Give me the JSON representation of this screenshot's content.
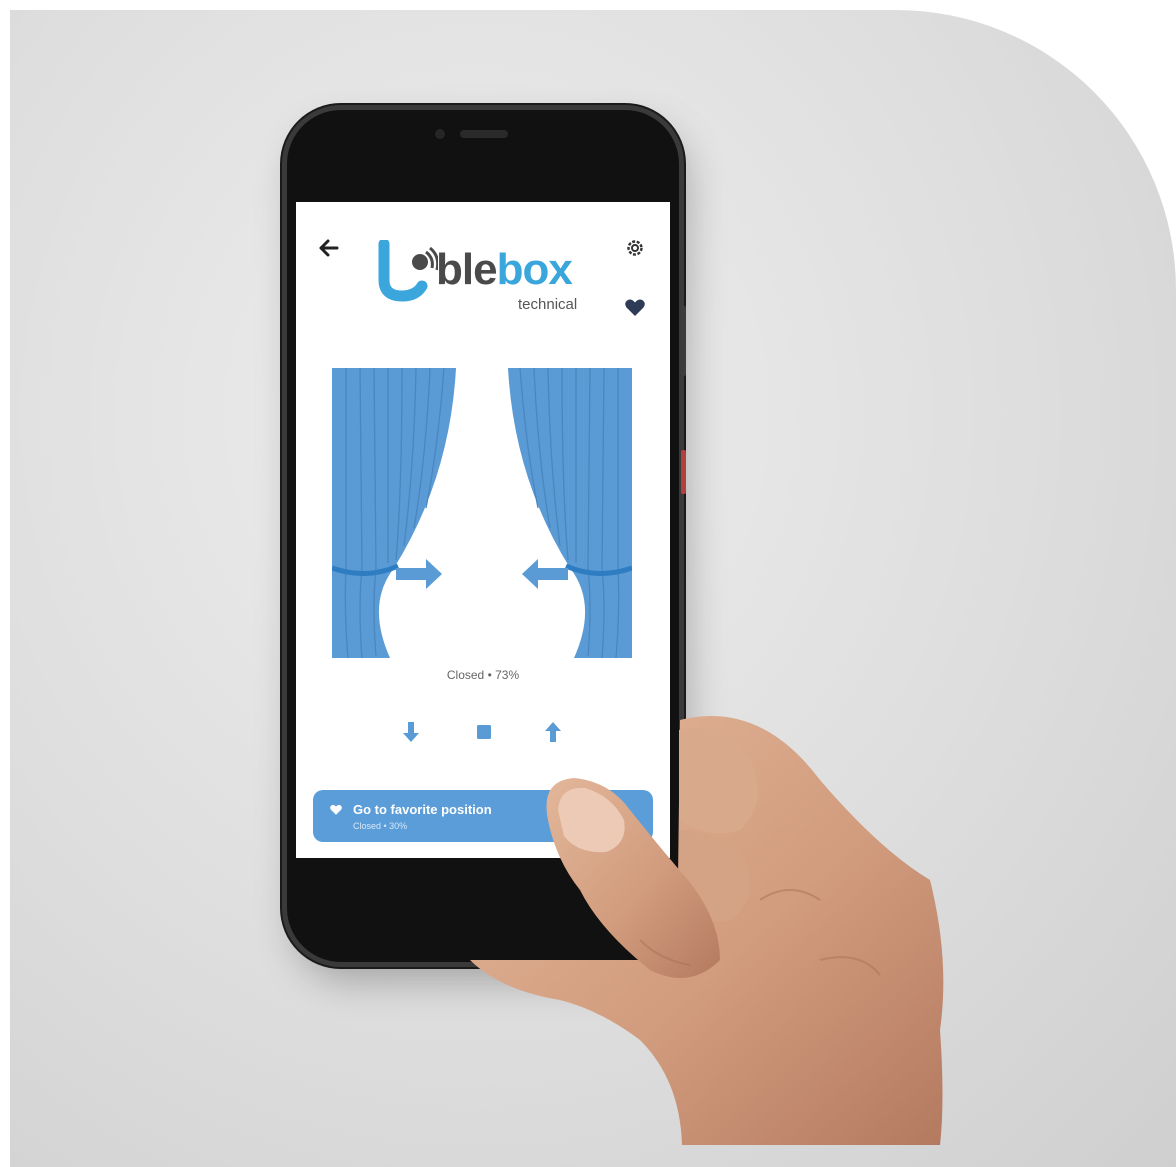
{
  "app": {
    "brand": {
      "name_part1": "ble",
      "name_part2": "box",
      "subtitle": "technical"
    },
    "header": {
      "back_icon": "arrow-left-icon",
      "settings_icon": "gear-icon",
      "favorite_icon": "heart-icon"
    },
    "status": {
      "text": "Closed • 73%"
    },
    "controls": {
      "down_icon": "arrow-down-icon",
      "stop_icon": "stop-square-icon",
      "up_icon": "arrow-up-icon"
    },
    "favorite": {
      "title": "Go to favorite position",
      "subtitle": "Closed • 30%"
    }
  },
  "colors": {
    "accent": "#5b9dd9",
    "curtain": "#5a9bd5",
    "logo_dark": "#4a4a4a",
    "icon_dark": "#2d3b57"
  }
}
